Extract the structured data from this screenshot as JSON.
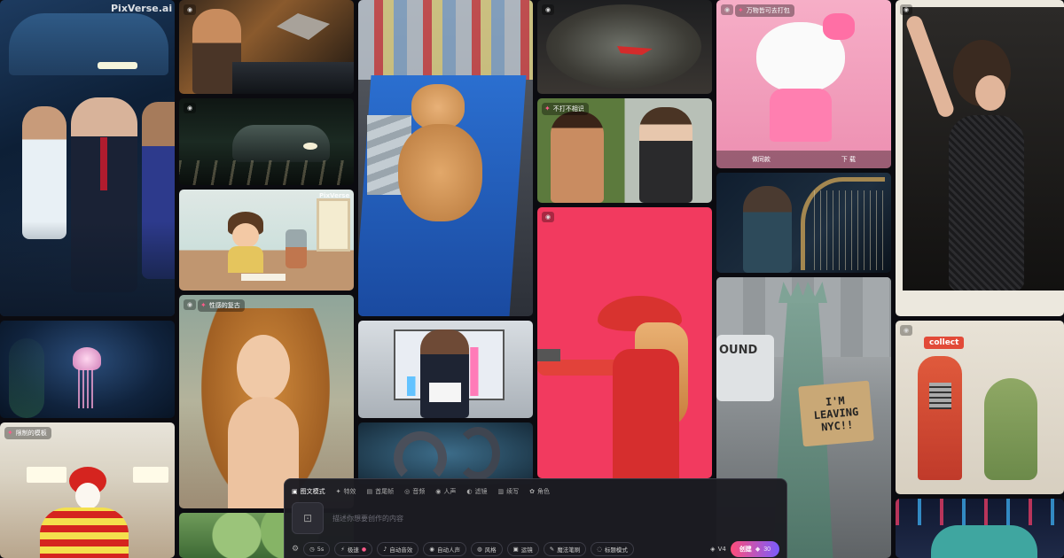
{
  "brand": {
    "watermark": "PixVerse.ai",
    "watermark_small": "PixVerse"
  },
  "tiles": {
    "football_badge": "",
    "t3_badge": "",
    "jelly_badge": "",
    "mcd_badge": "限制的模板",
    "venus_badge": "性感的复古",
    "twilight_badge": "不打不相识",
    "kitty_badge": "万物皆可去打包",
    "kitty_actions": [
      "做同款",
      "下 载"
    ],
    "collect_sign": "collect",
    "sign_text_1": "I'M",
    "sign_text_2": "LEAVING",
    "sign_text_3": "NYC!!",
    "bus_text": "OUND"
  },
  "composer": {
    "tabs": [
      {
        "icon": "image-icon",
        "label": "图文模式",
        "active": true
      },
      {
        "icon": "effects-icon",
        "label": "特效",
        "active": false
      },
      {
        "icon": "frames-icon",
        "label": "首尾帧",
        "active": false
      },
      {
        "icon": "music-icon",
        "label": "音频",
        "active": false
      },
      {
        "icon": "voice-icon",
        "label": "人声",
        "active": false
      },
      {
        "icon": "filter-icon",
        "label": "滤镜",
        "active": false
      },
      {
        "icon": "restyle-icon",
        "label": "续写",
        "active": false
      },
      {
        "icon": "character-icon",
        "label": "角色",
        "active": false
      }
    ],
    "upload_icon": "image-upload-icon",
    "placeholder": "描述你想要创作的内容",
    "chips": [
      {
        "label": "5s",
        "icon": "clock-icon"
      },
      {
        "label": "极速",
        "icon": "bolt-icon"
      },
      {
        "label": "自动音效",
        "icon": "music-icon"
      },
      {
        "label": "自动人声",
        "icon": "voice-icon"
      },
      {
        "label": "风格",
        "icon": "palette-icon"
      },
      {
        "label": "运镜",
        "icon": "camera-icon"
      },
      {
        "label": "魔法笔刷",
        "icon": "brush-icon"
      },
      {
        "label": "标题模式",
        "icon": "title-icon"
      }
    ],
    "model": "V4",
    "create_label": "创建",
    "create_cost": "30"
  },
  "colors": {
    "accent_pink": "#ff4d7a",
    "accent_purple": "#7a5cff",
    "panel": "#1c1c22"
  }
}
